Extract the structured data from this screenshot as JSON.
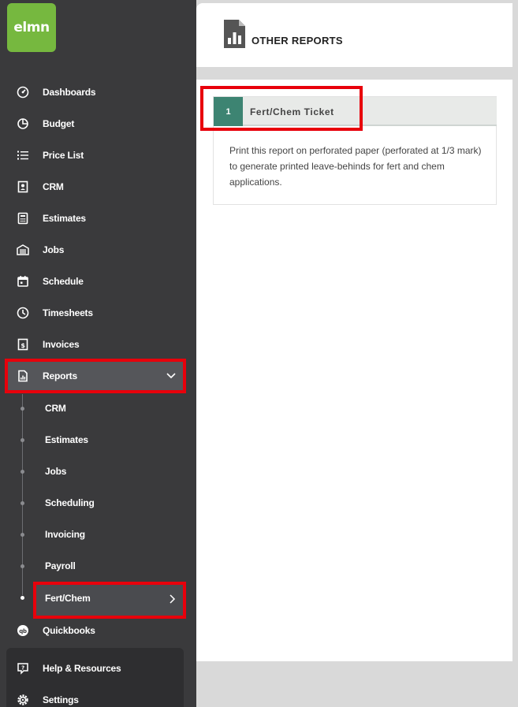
{
  "logo": {
    "text": "elmn"
  },
  "sidebar": {
    "items": [
      {
        "label": "Dashboards",
        "icon": "dashboard-icon"
      },
      {
        "label": "Budget",
        "icon": "pie-chart-icon"
      },
      {
        "label": "Price List",
        "icon": "list-icon"
      },
      {
        "label": "CRM",
        "icon": "contact-card-icon"
      },
      {
        "label": "Estimates",
        "icon": "calculator-icon"
      },
      {
        "label": "Jobs",
        "icon": "garage-icon"
      },
      {
        "label": "Schedule",
        "icon": "calendar-icon"
      },
      {
        "label": "Timesheets",
        "icon": "clock-icon"
      },
      {
        "label": "Invoices",
        "icon": "invoice-icon"
      },
      {
        "label": "Reports",
        "icon": "report-icon"
      }
    ],
    "report_sub_items": [
      "CRM",
      "Estimates",
      "Jobs",
      "Scheduling",
      "Invoicing",
      "Payroll",
      "Fert/Chem"
    ],
    "quickbooks": {
      "label": "Quickbooks",
      "icon": "quickbooks-icon"
    },
    "help": {
      "label": "Help & Resources",
      "icon": "help-icon"
    },
    "settings": {
      "label": "Settings",
      "icon": "settings-icon"
    }
  },
  "header": {
    "title": "OTHER REPORTS",
    "icon": "report-document-icon"
  },
  "report": {
    "number": "1",
    "title": "Fert/Chem Ticket",
    "description": "Print this report on perforated paper (perforated at 1/3 mark) to generate printed leave-behinds for fert and chem applications."
  },
  "colors": {
    "sidebar_bg": "#3a3a3c",
    "logo_green": "#76b83f",
    "badge_teal": "#3d8472",
    "highlight_red": "#e8000b"
  }
}
